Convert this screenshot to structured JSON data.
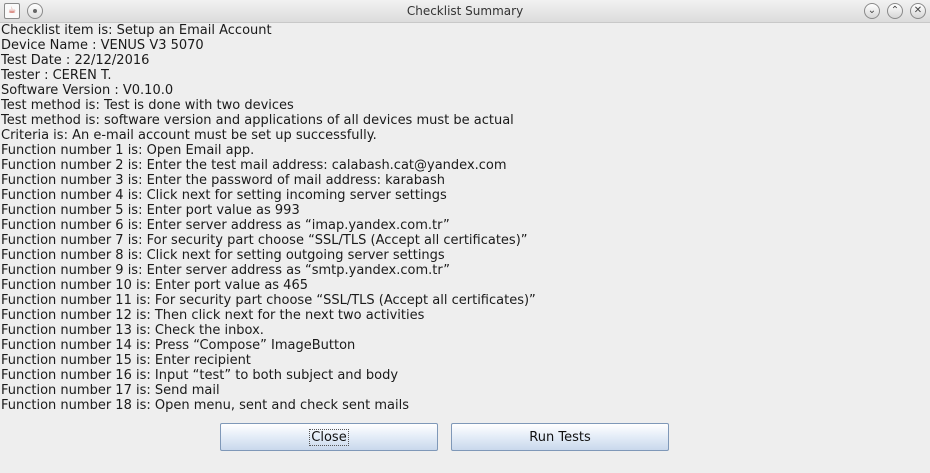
{
  "window": {
    "title": "Checklist Summary",
    "buttons": {
      "minimize_symbol": "⌄",
      "maximize_symbol": "⌃",
      "close_symbol": "✕"
    }
  },
  "summary_lines": [
    "Checklist item is: Setup an Email Account",
    "Device Name : VENUS V3 5070",
    "Test Date : 22/12/2016",
    "Tester : CEREN T.",
    "Software Version : V0.10.0",
    "Test method is: Test is done with two devices",
    "Test method is: software version and applications of all devices must be actual",
    "Criteria is: An e-mail account must be set up successfully.",
    "Function number 1 is: Open Email app.",
    "Function number 2 is: Enter the test mail address: calabash.cat@yandex.com",
    "Function number 3 is: Enter the password of mail address: karabash",
    "Function number 4 is: Click next for setting incoming server settings",
    "Function number 5 is: Enter port value as 993",
    "Function number 6 is: Enter server address as “imap.yandex.com.tr”",
    "Function number 7 is: For security part choose “SSL/TLS (Accept all certificates)”",
    "Function number 8 is: Click next for setting outgoing server settings",
    "Function number 9 is: Enter server address as “smtp.yandex.com.tr”",
    "Function number 10 is: Enter port value as 465",
    "Function number 11 is: For security part choose “SSL/TLS (Accept all certificates)”",
    "Function number 12 is: Then click next for the next two activities",
    "Function number 13 is: Check the inbox.",
    "Function number 14 is: Press “Compose” ImageButton",
    "Function number 15 is: Enter recipient",
    "Function number 16 is: Input “test” to both subject and body",
    "Function number 17 is: Send mail",
    "Function number 18 is: Open menu, sent and check sent mails"
  ],
  "actions": {
    "close_label": "Close",
    "run_tests_label": "Run Tests"
  }
}
